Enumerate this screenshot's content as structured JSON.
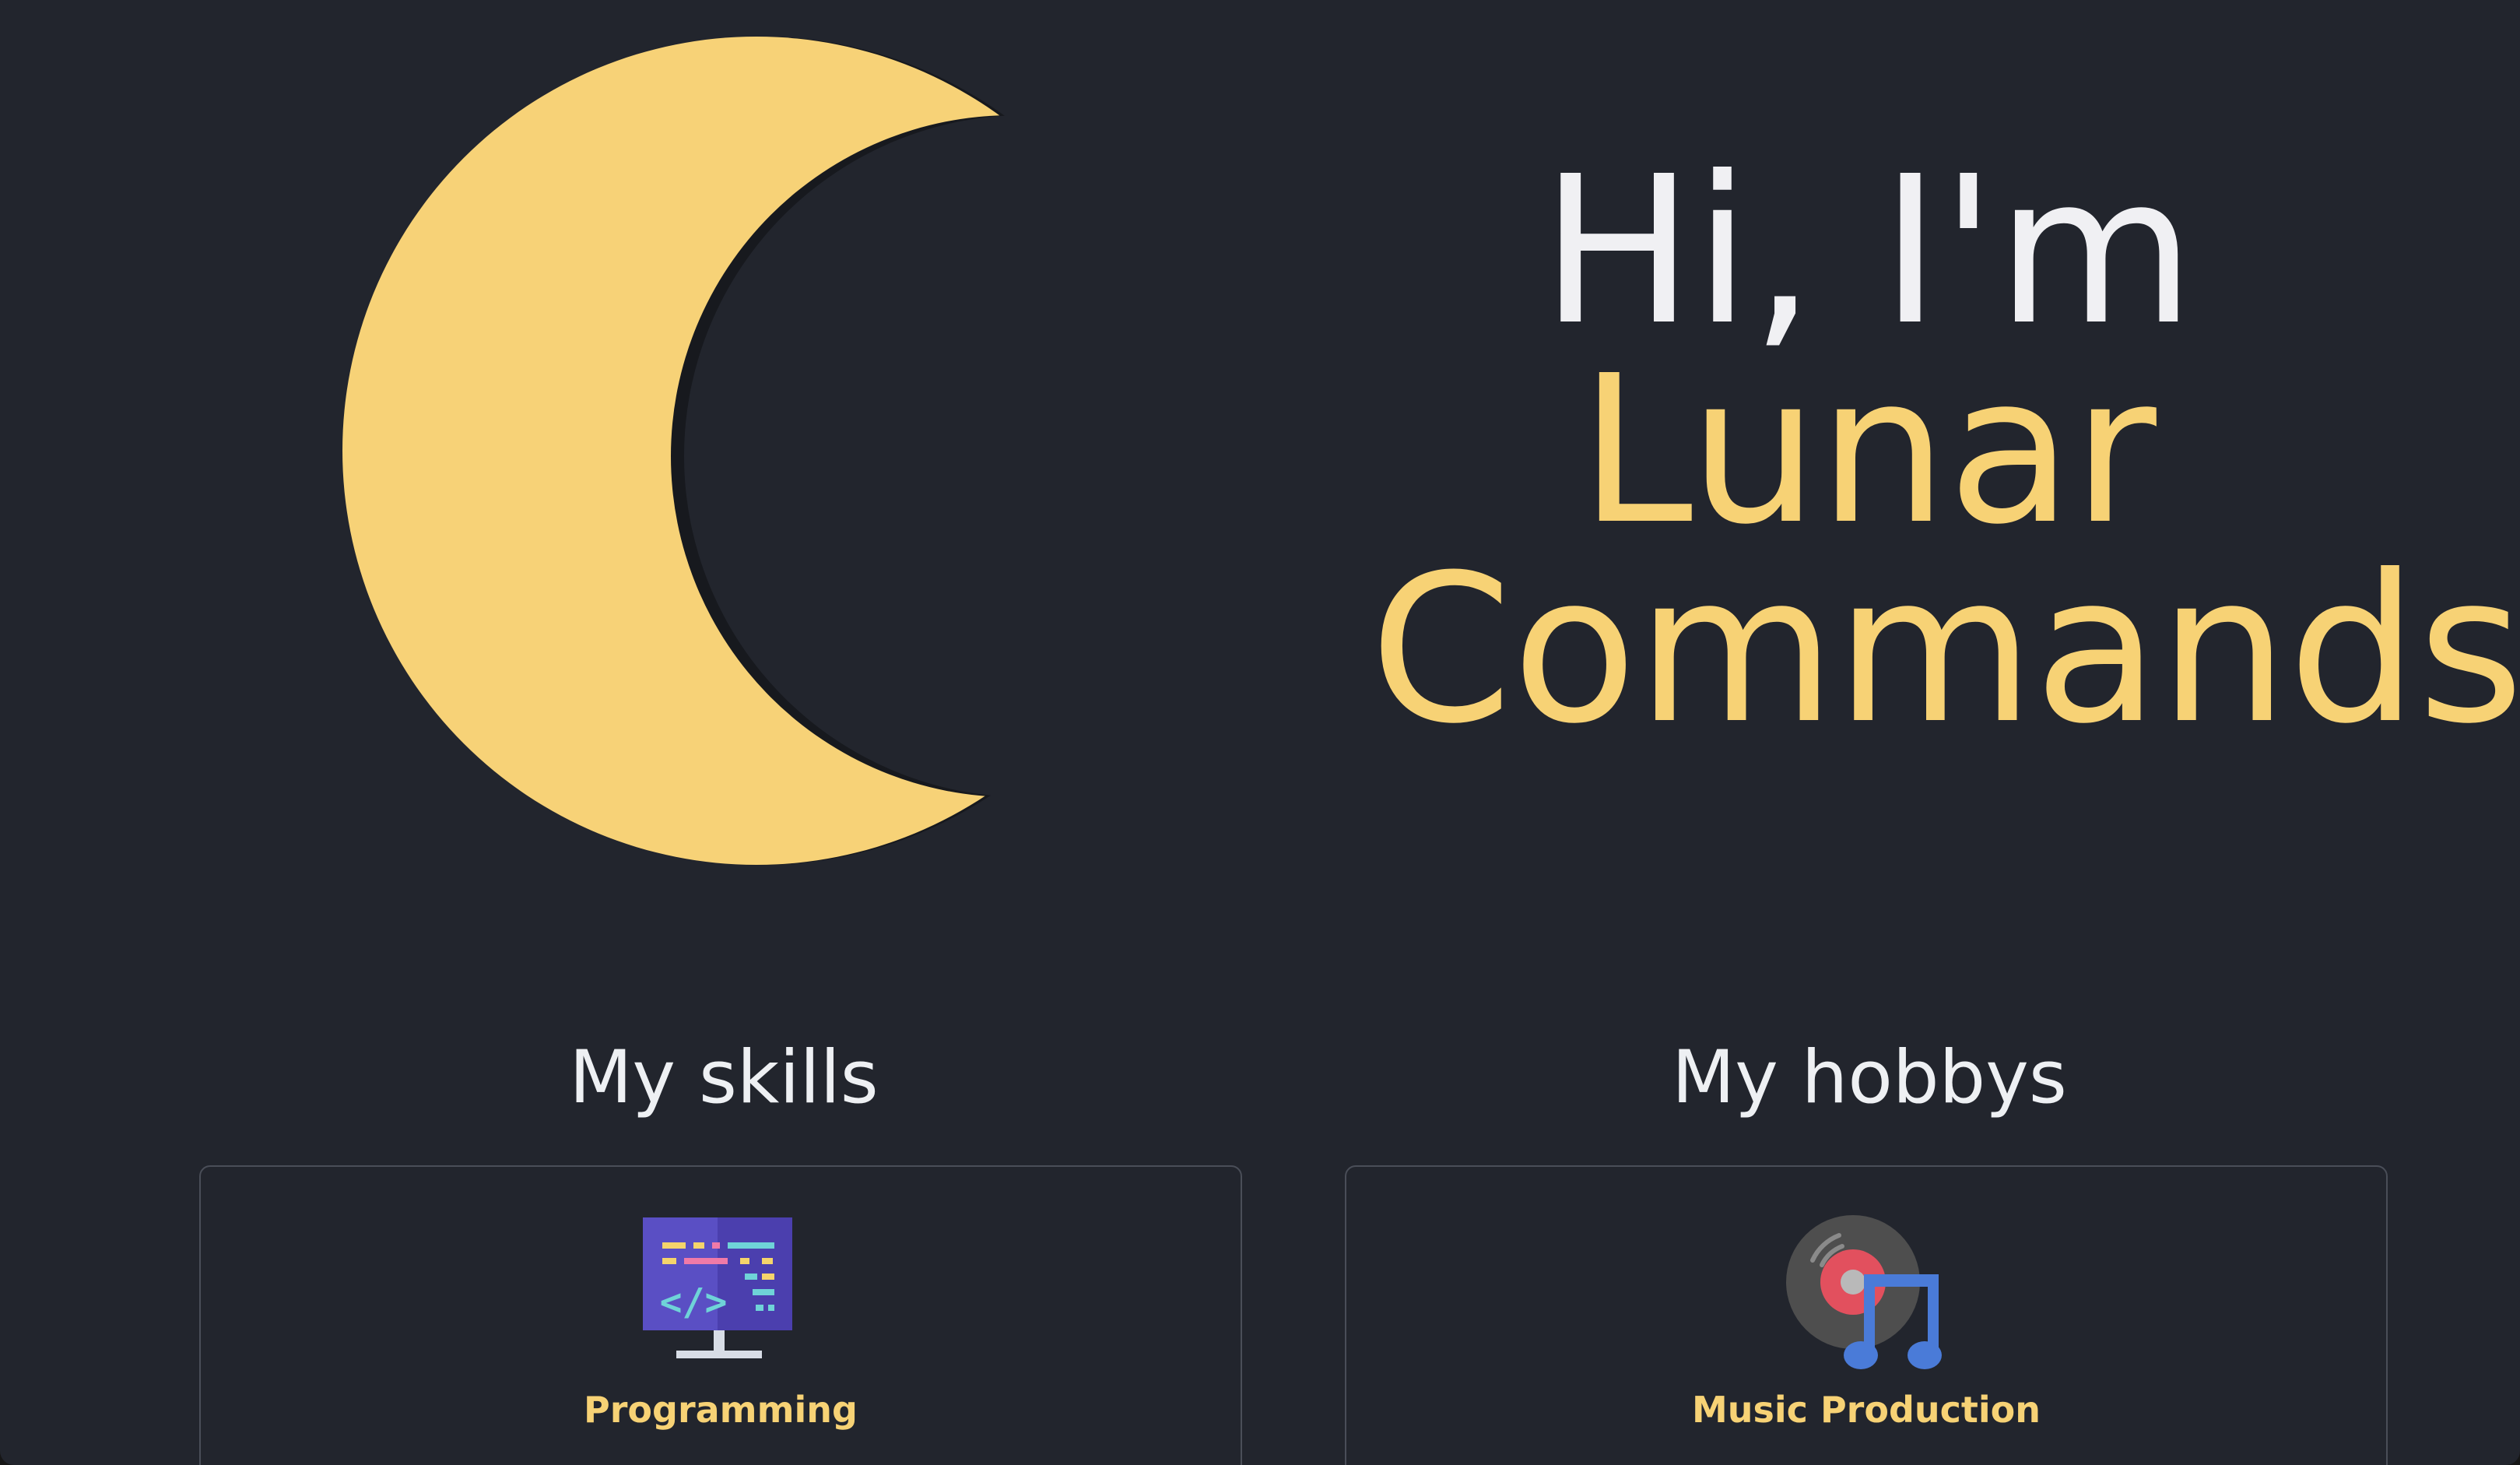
{
  "hero": {
    "greeting": "Hi, I'm",
    "name_line1": "Lunar",
    "name_line2": "Commands"
  },
  "sections": {
    "skills": {
      "title": "My skills",
      "items": [
        {
          "label": "Programming",
          "icon": "code-monitor-icon"
        }
      ]
    },
    "hobbys": {
      "title": "My hobbys",
      "items": [
        {
          "label": "Music Production",
          "icon": "vinyl-music-note-icon"
        }
      ]
    }
  },
  "colors": {
    "background": "#22252d",
    "accent": "#f7d275",
    "text": "#f0f0f3",
    "card_border": "#4a4e58"
  }
}
